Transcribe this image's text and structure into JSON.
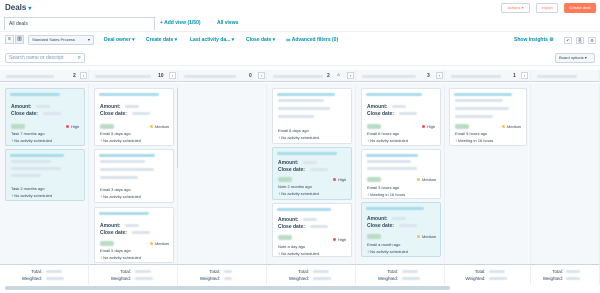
{
  "header": {
    "title": "Deals",
    "actions_label": "Actions",
    "import_label": "Import",
    "create_label": "Create deal"
  },
  "tabs": {
    "current": "All deals",
    "add_view": "+ Add view (1/50)",
    "all_views": "All views"
  },
  "filters": {
    "pipeline": "Standard Sales Process",
    "deal_owner": "Deal owner",
    "create_date": "Create date",
    "last_activity": "Last activity da...",
    "close_date": "Close date",
    "advanced": "Advanced filters (0)",
    "show_insights": "Show Insights"
  },
  "search": {
    "placeholder": "Search name or descript",
    "board_options": "Board options"
  },
  "columns": [
    {
      "count": "2"
    },
    {
      "count": "10"
    },
    {
      "count": "0"
    },
    {
      "count": "2"
    },
    {
      "count": "3"
    },
    {
      "count": "1"
    }
  ],
  "labels": {
    "amount": "Amount:",
    "close_date": "Close date:",
    "no_activity": "No activity scheduled",
    "total": "Total:",
    "weighted": "Weighted:"
  },
  "cards": {
    "c1": {
      "priority": "High",
      "activity": "Task 7 months ago"
    },
    "c2": {
      "activity": "Task 2 months ago"
    },
    "c3": {
      "priority": "Medium",
      "activity": "Email 5 days ago"
    },
    "c4": {
      "activity": "Email 3 days ago"
    },
    "c5": {
      "priority": "Medium",
      "activity": "Email 5 days ago"
    },
    "c6": {
      "activity": "Email 6 days ago"
    },
    "c7": {
      "priority": "High",
      "activity": "Note 2 months ago"
    },
    "c8": {
      "priority": "High",
      "activity": "Note a day ago"
    },
    "c9": {
      "priority": "High",
      "activity": "Email 6 hours ago"
    },
    "c10": {
      "priority": "Medium",
      "activity": "Email 3 hours ago",
      "next": "Meeting in 16 hours"
    },
    "c11": {
      "priority": "Medium",
      "activity": "Email a month ago"
    },
    "c12": {
      "priority": "Medium",
      "activity": "Email 5 hours ago",
      "next": "Meeting in 16 hours"
    }
  },
  "colors": {
    "accent": "#ff7a59",
    "link": "#0091ae",
    "high": "#f2545b",
    "medium": "#f5c26b"
  }
}
